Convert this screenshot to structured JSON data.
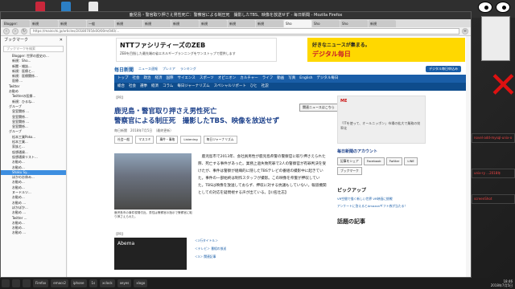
{
  "window": {
    "title": "鹿児島・警官取り押さえ男性死亡：警察官による制圧死　撮影したTBS、映像を放送せず - 毎日新聞 - Mozilla Firefox",
    "url": "https://mainichi.jp/articles/20180705/k00/00m/040/..."
  },
  "tabs": [
    "Blogger:",
    "新規",
    "新規",
    "一般",
    "新規",
    "新規",
    "新規",
    "新規",
    "新規",
    "新規",
    "Sho",
    "Sho",
    "Sho",
    "新規"
  ],
  "sidebar": {
    "title": "ブックマーク",
    "search_placeholder": "ブックマークを検索",
    "items": [
      {
        "label": "Blogger: 世界の歴史の...",
        "level": 2
      },
      {
        "label": "新規：Sho...",
        "level": 2
      },
      {
        "label": "新聞・雑誌...",
        "level": 2
      },
      {
        "label": "新規：医療と...",
        "level": 2
      },
      {
        "label": "新規：医療関係...",
        "level": 2
      },
      {
        "label": "医療 ...",
        "level": 2
      },
      {
        "label": "Twitter",
        "level": 1
      },
      {
        "label": "お勧め",
        "level": 1
      },
      {
        "label": "Twitterの医療...",
        "level": 2
      },
      {
        "label": "新規：ひるね...",
        "level": 2
      },
      {
        "label": "グループ",
        "level": 1
      },
      {
        "label": "皇室関係 ...",
        "level": 2
      },
      {
        "label": "皇室関係...",
        "level": 2
      },
      {
        "label": "皇室関係 ...",
        "level": 2
      },
      {
        "label": "皇室関係...",
        "level": 2
      },
      {
        "label": "グループ",
        "level": 1
      },
      {
        "label": "松本工業Poko...",
        "level": 2
      },
      {
        "label": "松本工業...",
        "level": 2
      },
      {
        "label": "家族と...",
        "level": 2
      },
      {
        "label": "仮想通貨...",
        "level": 2
      },
      {
        "label": "仮想通貨リスト...",
        "level": 2
      },
      {
        "label": "お勧め...",
        "level": 2
      },
      {
        "label": "お勧め...",
        "level": 2
      },
      {
        "label": "Shaku Sy...",
        "level": 2,
        "selected": true
      },
      {
        "label": "ほかのお休み...",
        "level": 2
      },
      {
        "label": "お勧め...",
        "level": 2
      },
      {
        "label": "お勧め...",
        "level": 2
      },
      {
        "label": "ヌードルツ...",
        "level": 2
      },
      {
        "label": "お勧め...",
        "level": 2
      },
      {
        "label": "お勧め ...",
        "level": 2
      },
      {
        "label": "ぽかぽか...",
        "level": 2
      },
      {
        "label": "お勧め ...",
        "level": 2
      },
      {
        "label": "Twitter ...",
        "level": 2
      },
      {
        "label": "お勧め...",
        "level": 2
      },
      {
        "label": "お勧め...",
        "level": 2
      },
      {
        "label": "お勧め ...",
        "level": 2
      }
    ]
  },
  "ads": {
    "left_title": "NTTファシリティーズのZEB",
    "left_sub": "ZEBを目指した最先端の省エネルギープランニングをワンストップで提供します",
    "right_l1": "好きなニュースが集まる。",
    "right_l2": "デジタル毎日"
  },
  "masthead": {
    "logo": "毎日新聞",
    "links": [
      "ニュース速報",
      "プレミア",
      "ランキング"
    ],
    "button": "デジタル毎日申込み"
  },
  "nav1": [
    "トップ",
    "社会",
    "政治",
    "経済",
    "国際",
    "サイエンス",
    "スポーツ",
    "オピニオン",
    "カルチャー",
    "ライフ",
    "動画",
    "写真",
    "English",
    "デジタル毎日"
  ],
  "nav2": [
    "総合",
    "社会",
    "選挙",
    "経済",
    "コラム",
    "毎日ジャーナリズム",
    "スペシャルリポート",
    "ひと",
    "社説"
  ],
  "article": {
    "breadcrumb": "【PR】",
    "headline_1": "鹿児島・警官取り押さえ男性死亡",
    "headline_2": "警察官による制圧死　撮影したTBS、映像を放送せず",
    "follow_button": "関連ニュースはこちら",
    "dateline": "毎日新聞　2018年7月5日　（最終更新）",
    "share": [
      "社会一般",
      "マスコミ",
      "事件・事故",
      "Listening",
      "毎日ジャーナリズム"
    ],
    "body": "　鹿児島市で2013年、会社員男性が鹿児島県警の警察官に取り押さえられた際、死亡する事件があった。業務上過失致死罪で2人の警察官が有罪判決を受けたが、事件は警察が組織的に隠したTBSテレビの番組の撮影中に起きていた。事件の一部始終は制作スタッフが撮影。この映像を県警が押収していた。TBSは映像を放送しておらず、押収に対する抗議もしていない。報道機関としての対応を疑問視する声が出ている。【川名壮志】",
    "caption": "鹿児島市の事件現場付近。男性は警察官の指示で警察官に取り押さえられた。",
    "pr_label": "【PR】",
    "pr_box": "Abema",
    "related": [
      "＜1行タイトル＞",
      "＜テレビ＞ 番組の放送",
      "＜3＞ 関連記事"
    ]
  },
  "right": {
    "ad_brand": "ME",
    "ad_text": "「ITを使って、オールニッポン」市場の拡大で業務の効率化",
    "title": "毎日新聞のアカウント",
    "buttons": [
      "記事をシェア",
      "Facebook",
      "Twitter",
      "LINE",
      "ブックマーク"
    ],
    "pickup": "ピックアップ",
    "pickup_items": [
      "VR空間で描く新しい世界 VR映画に挑戦",
      "アンケートに答えるとAmazonギフト券が当たる！"
    ],
    "topic": "話題の記事"
  },
  "widgets": [
    "novel-add-mysql-unix-o",
    "unix-ry ...2018年",
    "screenShot"
  ],
  "taskbar": {
    "items": [
      "",
      "",
      "",
      "Firefox",
      "emacs2",
      "iphone",
      "1s",
      "xclock",
      "xeyes",
      "xlogo"
    ],
    "clock_time": "18:46",
    "clock_date": "2018年7月5日"
  }
}
